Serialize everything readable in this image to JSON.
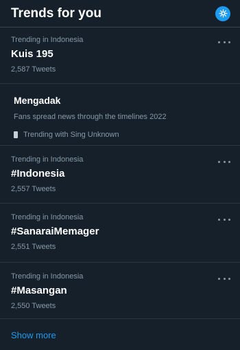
{
  "header": {
    "title": "Trends for you",
    "settings_icon": "gear-icon",
    "accent": "#1d9bf0"
  },
  "trends": [
    {
      "meta": "Trending in Indonesia",
      "name": "Kuis 195",
      "count": "2,587 Tweets"
    },
    {
      "meta": "Trending in Indonesia",
      "name": "#Indonesia",
      "count": "2,557 Tweets"
    },
    {
      "meta": "Trending in Indonesia",
      "name": "#SanaraiMemager",
      "count": "2,551 Tweets"
    },
    {
      "meta": "Trending in Indonesia",
      "name": "#Masangan",
      "count": "2,550 Tweets"
    }
  ],
  "news": {
    "name": "Mengadak",
    "description": "Fans spread news through the timelines 2022",
    "related": "Trending with Sing Unknown"
  },
  "footer": {
    "show_more": "Show more"
  }
}
